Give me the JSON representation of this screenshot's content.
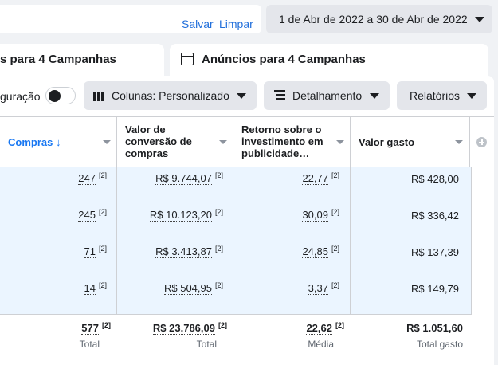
{
  "header": {
    "save_label": "Salvar",
    "clear_label": "Limpar",
    "date_range": "1 de Abr de 2022 a 30 de Abr de 2022"
  },
  "tabs": {
    "ad_sets": "s para 4 Campanhas",
    "ads": "Anúncios para 4 Campanhas"
  },
  "toolbar": {
    "config_label": "guração",
    "columns_label": "Colunas: Personalizado",
    "breakdown_label": "Detalhamento",
    "reports_label": "Relatórios"
  },
  "table": {
    "headers": {
      "purchases": "Compras ↓",
      "conversion_value": [
        "Valor de",
        "conversão de",
        "compras"
      ],
      "roas": [
        "Retorno sobre o",
        "investimento em",
        "publicidade…"
      ],
      "spent": "Valor gasto"
    },
    "rows": [
      {
        "purchases": "247",
        "conversion_value": "R$ 9.744,07",
        "roas": "22,77",
        "spent": "R$ 428,00"
      },
      {
        "purchases": "245",
        "conversion_value": "R$ 10.123,20",
        "roas": "30,09",
        "spent": "R$ 336,42"
      },
      {
        "purchases": "71",
        "conversion_value": "R$ 3.413,87",
        "roas": "24,85",
        "spent": "R$ 137,39"
      },
      {
        "purchases": "14",
        "conversion_value": "R$ 504,95",
        "roas": "3,37",
        "spent": "R$ 149,79"
      }
    ],
    "footnote": "[2]",
    "totals": {
      "purchases": "577",
      "purchases_label": "Total",
      "conversion_value": "R$ 23.786,09",
      "conversion_value_label": "Total",
      "roas": "22,62",
      "roas_label": "Média",
      "spent": "R$ 1.051,60",
      "spent_label": "Total gasto"
    }
  },
  "colors": {
    "link": "#216fdb",
    "row_bg": "#ebf5ff",
    "accent": "#1877f2"
  }
}
